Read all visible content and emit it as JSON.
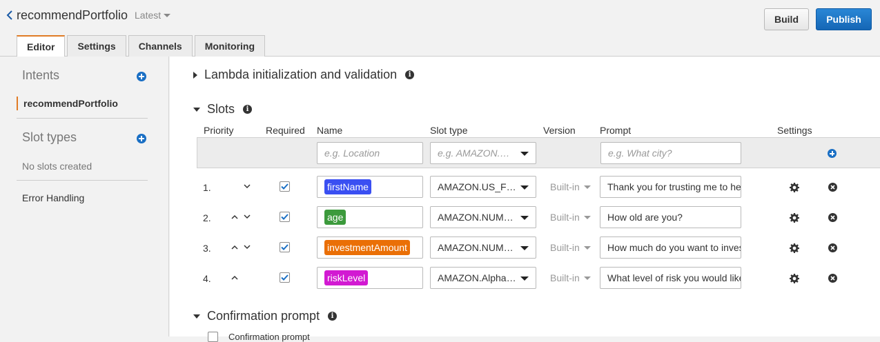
{
  "header": {
    "bot_name": "recommendPortfolio",
    "version": "Latest",
    "build_label": "Build",
    "publish_label": "Publish",
    "tabs": [
      {
        "label": "Editor",
        "active": true
      },
      {
        "label": "Settings",
        "active": false
      },
      {
        "label": "Channels",
        "active": false
      },
      {
        "label": "Monitoring",
        "active": false
      }
    ]
  },
  "sidebar": {
    "intents_title": "Intents",
    "intents": [
      "recommendPortfolio"
    ],
    "slot_types_title": "Slot types",
    "no_slots_text": "No slots created",
    "error_handling_label": "Error Handling"
  },
  "main": {
    "lambda_title": "Lambda initialization and validation",
    "slots_title": "Slots",
    "confirmation_title": "Confirmation prompt",
    "confirmation_checkbox_label": "Confirmation prompt",
    "columns": {
      "priority": "Priority",
      "required": "Required",
      "name": "Name",
      "slot_type": "Slot type",
      "version": "Version",
      "prompt": "Prompt",
      "settings": "Settings"
    },
    "new_slot": {
      "name_placeholder": "e.g. Location",
      "type_placeholder": "e.g. AMAZON.…",
      "prompt_placeholder": "e.g. What city?"
    },
    "slots": [
      {
        "priority": "1.",
        "required": true,
        "name": "firstName",
        "name_color": "#3a4ff2",
        "type": "AMAZON.US_FIRST_NAME",
        "version": "Built-in",
        "prompt": "Thank you for trusting me to help"
      },
      {
        "priority": "2.",
        "required": true,
        "name": "age",
        "name_color": "#3c9a3c",
        "type": "AMAZON.NUMBER",
        "version": "Built-in",
        "prompt": "How old are you?"
      },
      {
        "priority": "3.",
        "required": true,
        "name": "investmentAmount",
        "name_color": "#ea6f06",
        "type": "AMAZON.NUMBER",
        "version": "Built-in",
        "prompt": "How much do you want to invest?"
      },
      {
        "priority": "4.",
        "required": true,
        "name": "riskLevel",
        "name_color": "#d21ad2",
        "type": "AMAZON.AlphaNumeric",
        "version": "Built-in",
        "prompt": "What level of risk you would like"
      }
    ]
  },
  "colors": {
    "accent_orange": "#e07b24",
    "primary_blue": "#1a6fc4"
  }
}
